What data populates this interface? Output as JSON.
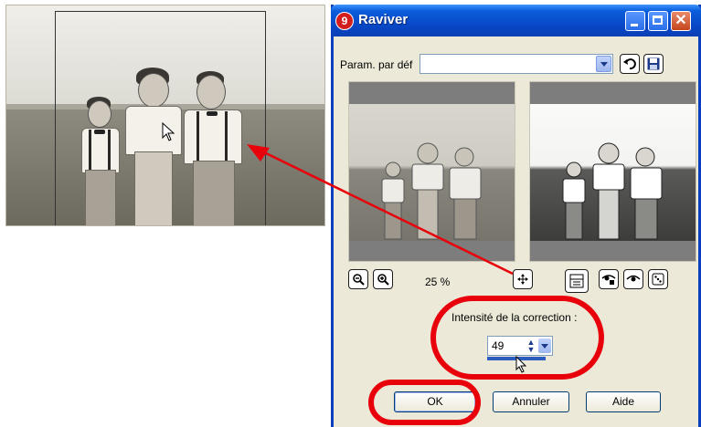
{
  "window": {
    "title": "Raviver",
    "title_icon": "9",
    "close_glyph": "✕"
  },
  "preset": {
    "label": "Param. par déf",
    "value": ""
  },
  "zoom": {
    "level": "25 %",
    "zoom_out_glyph": "🔍",
    "zoom_in_glyph": "🔍"
  },
  "correction": {
    "label": "Intensité de la correction :",
    "value": "49",
    "level_percent": 49
  },
  "buttons": {
    "ok": "OK",
    "cancel": "Annuler",
    "help": "Aide"
  },
  "colors": {
    "titlebar": "#0a5ddc",
    "dialog_bg": "#ece9d8",
    "annotation": "#e8000b"
  }
}
